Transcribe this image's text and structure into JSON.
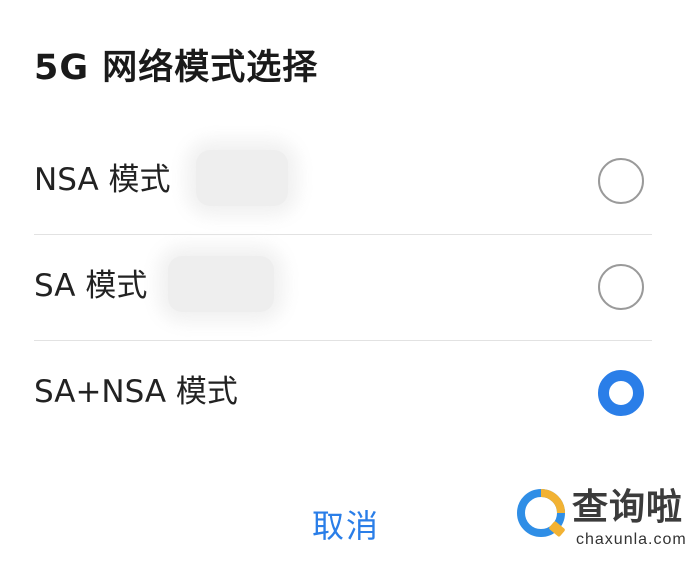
{
  "dialog": {
    "title": "5G 网络模式选择",
    "options": [
      {
        "label": "NSA 模式",
        "selected": false
      },
      {
        "label": "SA 模式",
        "selected": false
      },
      {
        "label": "SA+NSA 模式",
        "selected": true
      }
    ],
    "cancel_label": "取消"
  },
  "colors": {
    "accent": "#2a7ee8",
    "radio_unselected": "#9a9a9a",
    "divider": "#e2e2e2"
  },
  "watermark": {
    "brand_text": "查询啦",
    "domain_text": "chaxunla.com",
    "icon": "magnifier-q-logo-icon"
  }
}
